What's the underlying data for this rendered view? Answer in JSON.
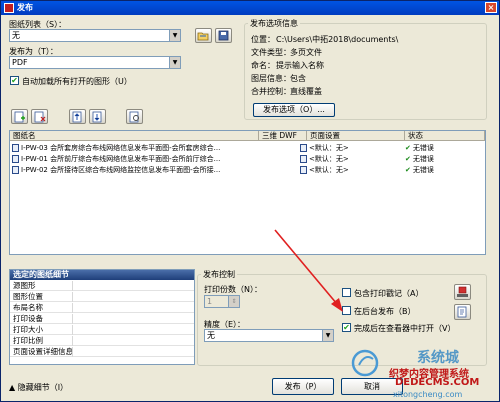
{
  "window": {
    "title": "发布",
    "close_glyph": "×"
  },
  "sheet_list": {
    "label": "图纸列表（S）：",
    "value": "无",
    "publish_to_label": "发布为（T）：",
    "publish_to_value": "PDF",
    "auto_load_label": "自动加载所有打开的图形（U）"
  },
  "publish_options_info": {
    "group_label": "发布选项信息",
    "location_label": "位置：",
    "location_value": "C:\\Users\\中拓2018\\documents\\",
    "filetype_label": "文件类型：",
    "filetype_value": "多页文件",
    "naming_label": "命名：",
    "naming_value": "提示输入名称",
    "layer_label": "图层信息：",
    "layer_value": "包含",
    "merge_label": "合并控制：",
    "merge_value": "直线覆盖",
    "button_label": "发布选项（O）..."
  },
  "sheets_table": {
    "headers": {
      "name": "图纸名",
      "3d": "三维 DWF",
      "page_setup": "页面设置",
      "status": "状态"
    },
    "rows": [
      {
        "name": "I-PW-03 会所套房综合布线网络信息发布平面图-会所套房综合...",
        "page_setup": "<默认：无>",
        "status": "无错误"
      },
      {
        "name": "I-PW-01 会所前厅综合布线网络信息发布平面图-会所前厅综合...",
        "page_setup": "<默认：无>",
        "status": "无错误"
      },
      {
        "name": "I-PW-02 会所接待区综合布线网络监控信息发布平面图-会所接...",
        "page_setup": "<默认：无>",
        "status": "无错误"
      }
    ]
  },
  "selected_details": {
    "header": "选定的图纸细节",
    "rows": [
      "源图形",
      "图形位置",
      "布局名称",
      "打印设备",
      "打印大小",
      "打印比例",
      "页面设置详细信息"
    ]
  },
  "publish_control": {
    "group_label": "发布控制",
    "copies_label": "打印份数（N）：",
    "copies_value": "1",
    "precision_label": "精度（E）：",
    "precision_value": "无",
    "include_stamp_label": "包含打印戳记（A）",
    "background_label": "在后台发布（B）",
    "open_viewer_label": "完成后在查看器中打开（V）"
  },
  "footer": {
    "hide_details_label": "隐藏细节（I）",
    "publish_button": "发布（P）",
    "cancel_button": "取消"
  },
  "watermark": {
    "brand": "系统城",
    "line1": "织梦内容管理系统",
    "line2": "DEDECMS.COM",
    "line3": "xitongcheng.com"
  },
  "colors": {
    "title_bar": "#0054e3",
    "panel": "#ece9d8",
    "arrow": "#e02020",
    "ok_tick": "#1a8a1a"
  }
}
